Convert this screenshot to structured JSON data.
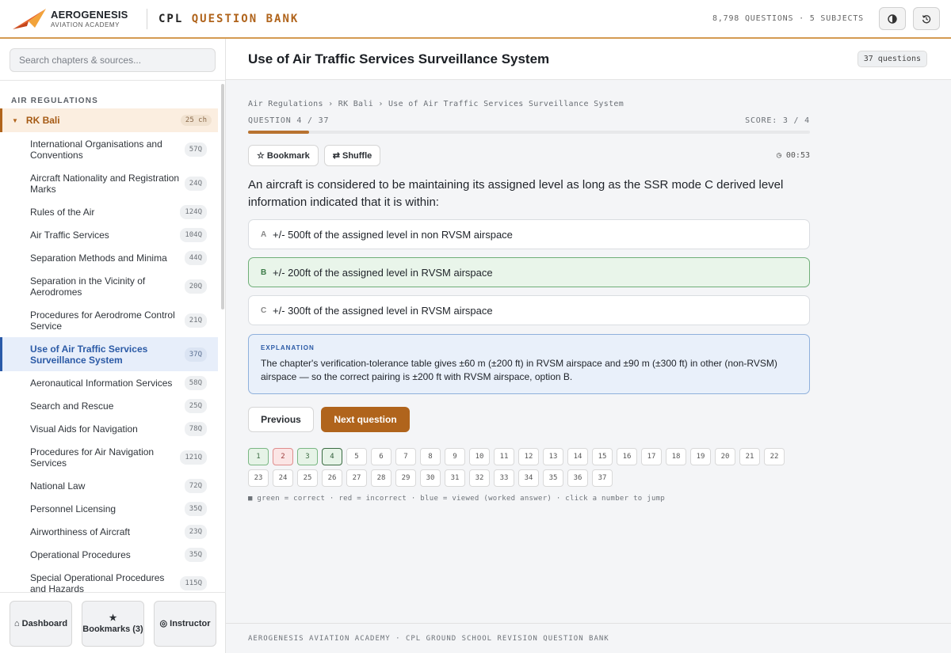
{
  "header": {
    "brand_name": "AEROGENESIS",
    "brand_sub": "AVIATION ACADEMY",
    "app_title_prefix": "CPL",
    "app_title_accent": "QUESTION BANK",
    "stats": "8,798 QUESTIONS · 5 SUBJECTS",
    "theme_icon": "contrast-icon",
    "reset_icon": "history-reset-icon",
    "accent_color": "#b0641c"
  },
  "sidebar": {
    "search_placeholder": "Search chapters & sources...",
    "subject": "AIR REGULATIONS",
    "book": {
      "label": "RK Bali",
      "count": "25 ch"
    },
    "chapters": [
      {
        "label": "International Organisations and Conventions",
        "count": "57Q"
      },
      {
        "label": "Aircraft Nationality and Registration Marks",
        "count": "24Q"
      },
      {
        "label": "Rules of the Air",
        "count": "124Q"
      },
      {
        "label": "Air Traffic Services",
        "count": "104Q"
      },
      {
        "label": "Separation Methods and Minima",
        "count": "44Q"
      },
      {
        "label": "Separation in the Vicinity of Aerodromes",
        "count": "20Q"
      },
      {
        "label": "Procedures for Aerodrome Control Service",
        "count": "21Q"
      },
      {
        "label": "Use of Air Traffic Services Surveillance System",
        "count": "37Q"
      },
      {
        "label": "Aeronautical Information Services",
        "count": "58Q"
      },
      {
        "label": "Search and Rescue",
        "count": "25Q"
      },
      {
        "label": "Visual Aids for Navigation",
        "count": "78Q"
      },
      {
        "label": "Procedures for Air Navigation Services",
        "count": "121Q"
      },
      {
        "label": "National Law",
        "count": "72Q"
      },
      {
        "label": "Personnel Licensing",
        "count": "35Q"
      },
      {
        "label": "Airworthiness of Aircraft",
        "count": "23Q"
      },
      {
        "label": "Operational Procedures",
        "count": "35Q"
      },
      {
        "label": "Special Operational Procedures and Hazards",
        "count": "115Q"
      }
    ],
    "footer": {
      "dashboard": "⌂ Dashboard",
      "bookmarks_title": "★",
      "bookmarks": "Bookmarks (3)",
      "instructor": "◎ Instructor"
    }
  },
  "main": {
    "title": "Use of Air Traffic Services Surveillance System",
    "count_badge": "37 questions",
    "breadcrumb": "Air Regulations › RK Bali › Use of Air Traffic Services Surveillance System",
    "question_label": "QUESTION 4 / 37",
    "score_label": "SCORE: 3 / 4",
    "progress_fraction": 0.108,
    "bookmark_label": "☆ Bookmark",
    "shuffle_label": "⇄ Shuffle",
    "timer": "◷ 00:53",
    "question": "An aircraft is considered to be maintaining its assigned level as long as the SSR mode C derived level information indicated that it is within:",
    "options": [
      {
        "letter": "A",
        "text": "+/- 500ft of the assigned level in non RVSM airspace"
      },
      {
        "letter": "B",
        "text": "+/- 200ft of the assigned level in RVSM airspace"
      },
      {
        "letter": "C",
        "text": "+/- 300ft of the assigned level in RVSM airspace"
      }
    ],
    "explanation_heading": "EXPLANATION",
    "explanation": "The chapter's verification-tolerance table gives ±60 m (±200 ft) in RVSM airspace and ±90 m (±300 ft) in other (non-RVSM) airspace — so the correct pairing is ±200 ft with RVSM airspace, option B.",
    "previous_label": "Previous",
    "next_label": "Next question",
    "legend": "■ green = correct · red = incorrect · blue = viewed (worked answer) · click a number to jump",
    "footer": "AEROGENESIS AVIATION ACADEMY · CPL GROUND SCHOOL REVISION QUESTION BANK"
  }
}
